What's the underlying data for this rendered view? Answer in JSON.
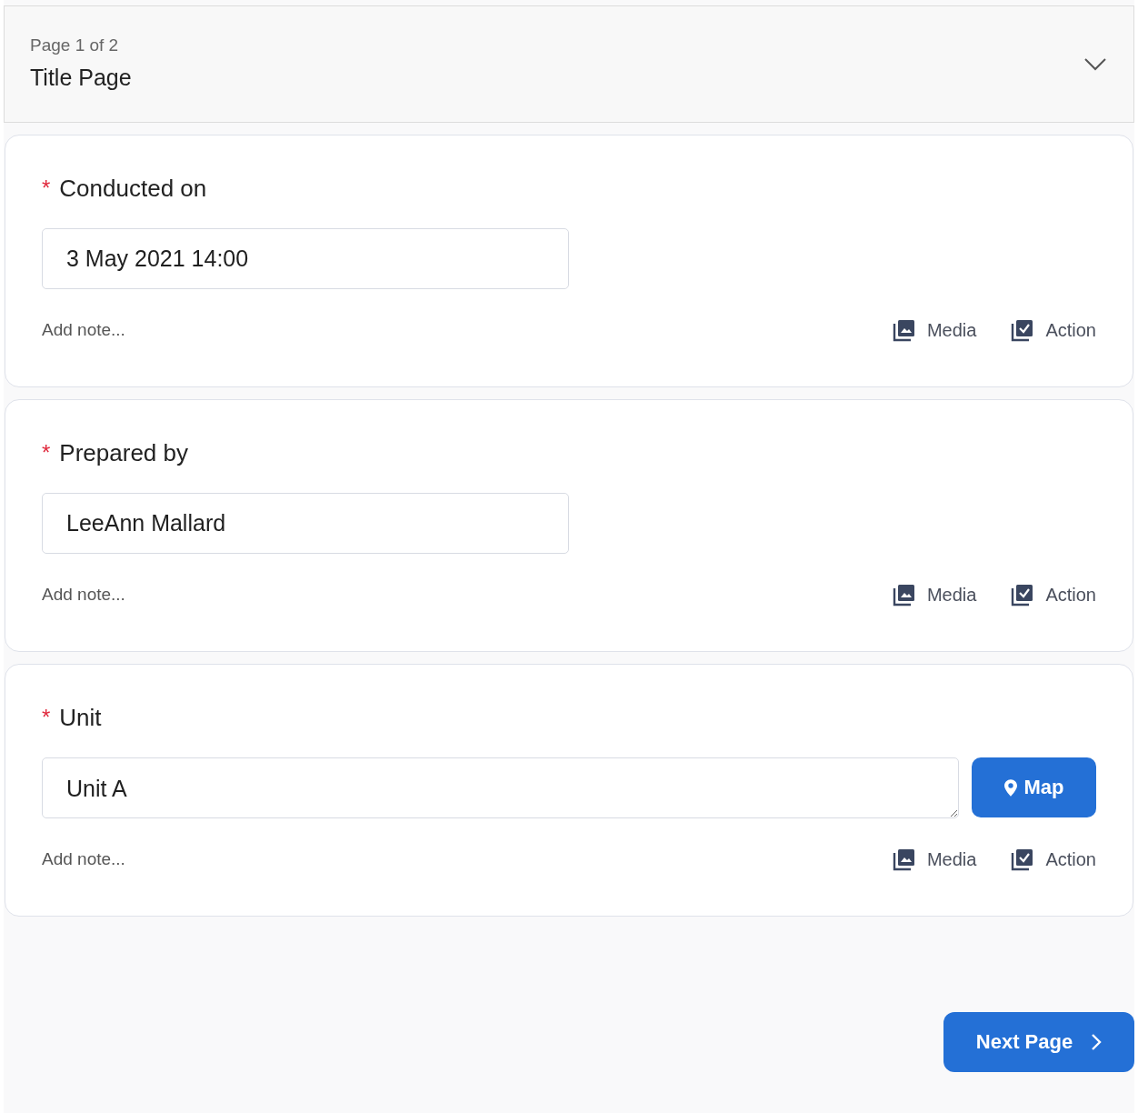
{
  "header": {
    "page_indicator": "Page 1 of 2",
    "title": "Title Page",
    "expanded": false
  },
  "questions": [
    {
      "kind": "text",
      "required": true,
      "required_mark": "*",
      "label": "Conducted on",
      "value": "3 May 2021 14:00",
      "note_placeholder": "Add note...",
      "media": "Media",
      "action": "Action"
    },
    {
      "kind": "text",
      "required": true,
      "required_mark": "*",
      "label": "Prepared by",
      "value": "LeeAnn Mallard",
      "note_placeholder": "Add note...",
      "media": "Media",
      "action": "Action"
    },
    {
      "kind": "location",
      "required": true,
      "required_mark": "*",
      "label": "Unit",
      "value": "Unit A",
      "map_button": "Map",
      "note_placeholder": "Add note...",
      "media": "Media",
      "action": "Action"
    }
  ],
  "next_button": "Next Page"
}
